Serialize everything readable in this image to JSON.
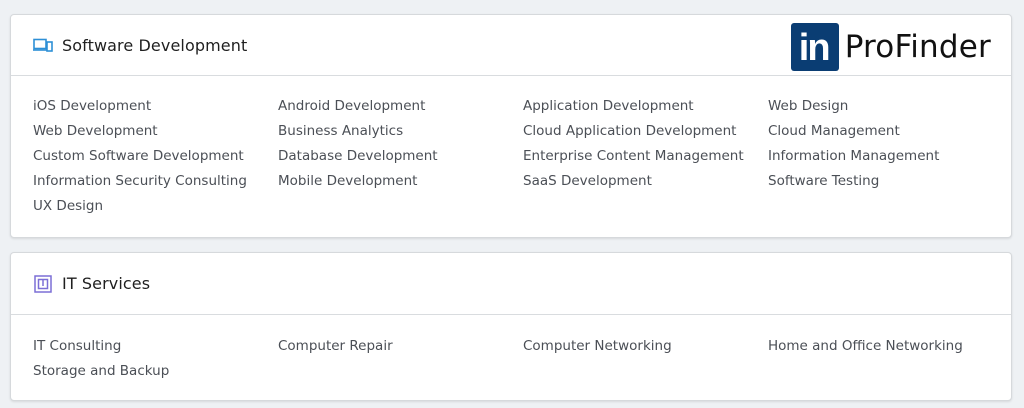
{
  "sections": [
    {
      "title": "Software Development",
      "icon": "devices-icon",
      "icon_color": "#2d8fd6",
      "logo": {
        "badge": "in",
        "text": "ProFinder",
        "badge_color": "#0a3d73"
      },
      "links": [
        "iOS Development",
        "Android Development",
        "Application Development",
        "Web Design",
        "Web Development",
        "Business Analytics",
        "Cloud Application Development",
        "Cloud Management",
        "Custom Software Development",
        "Database Development",
        "Enterprise Content Management",
        "Information Management",
        "Information Security Consulting",
        "Mobile Development",
        "SaaS Development",
        "Software Testing",
        "UX Design"
      ]
    },
    {
      "title": "IT Services",
      "icon": "chip-icon",
      "icon_color": "#7c6fd6",
      "links": [
        "IT Consulting",
        "Computer Repair",
        "Computer Networking",
        "Home and Office Networking",
        "Storage and Backup"
      ]
    }
  ]
}
